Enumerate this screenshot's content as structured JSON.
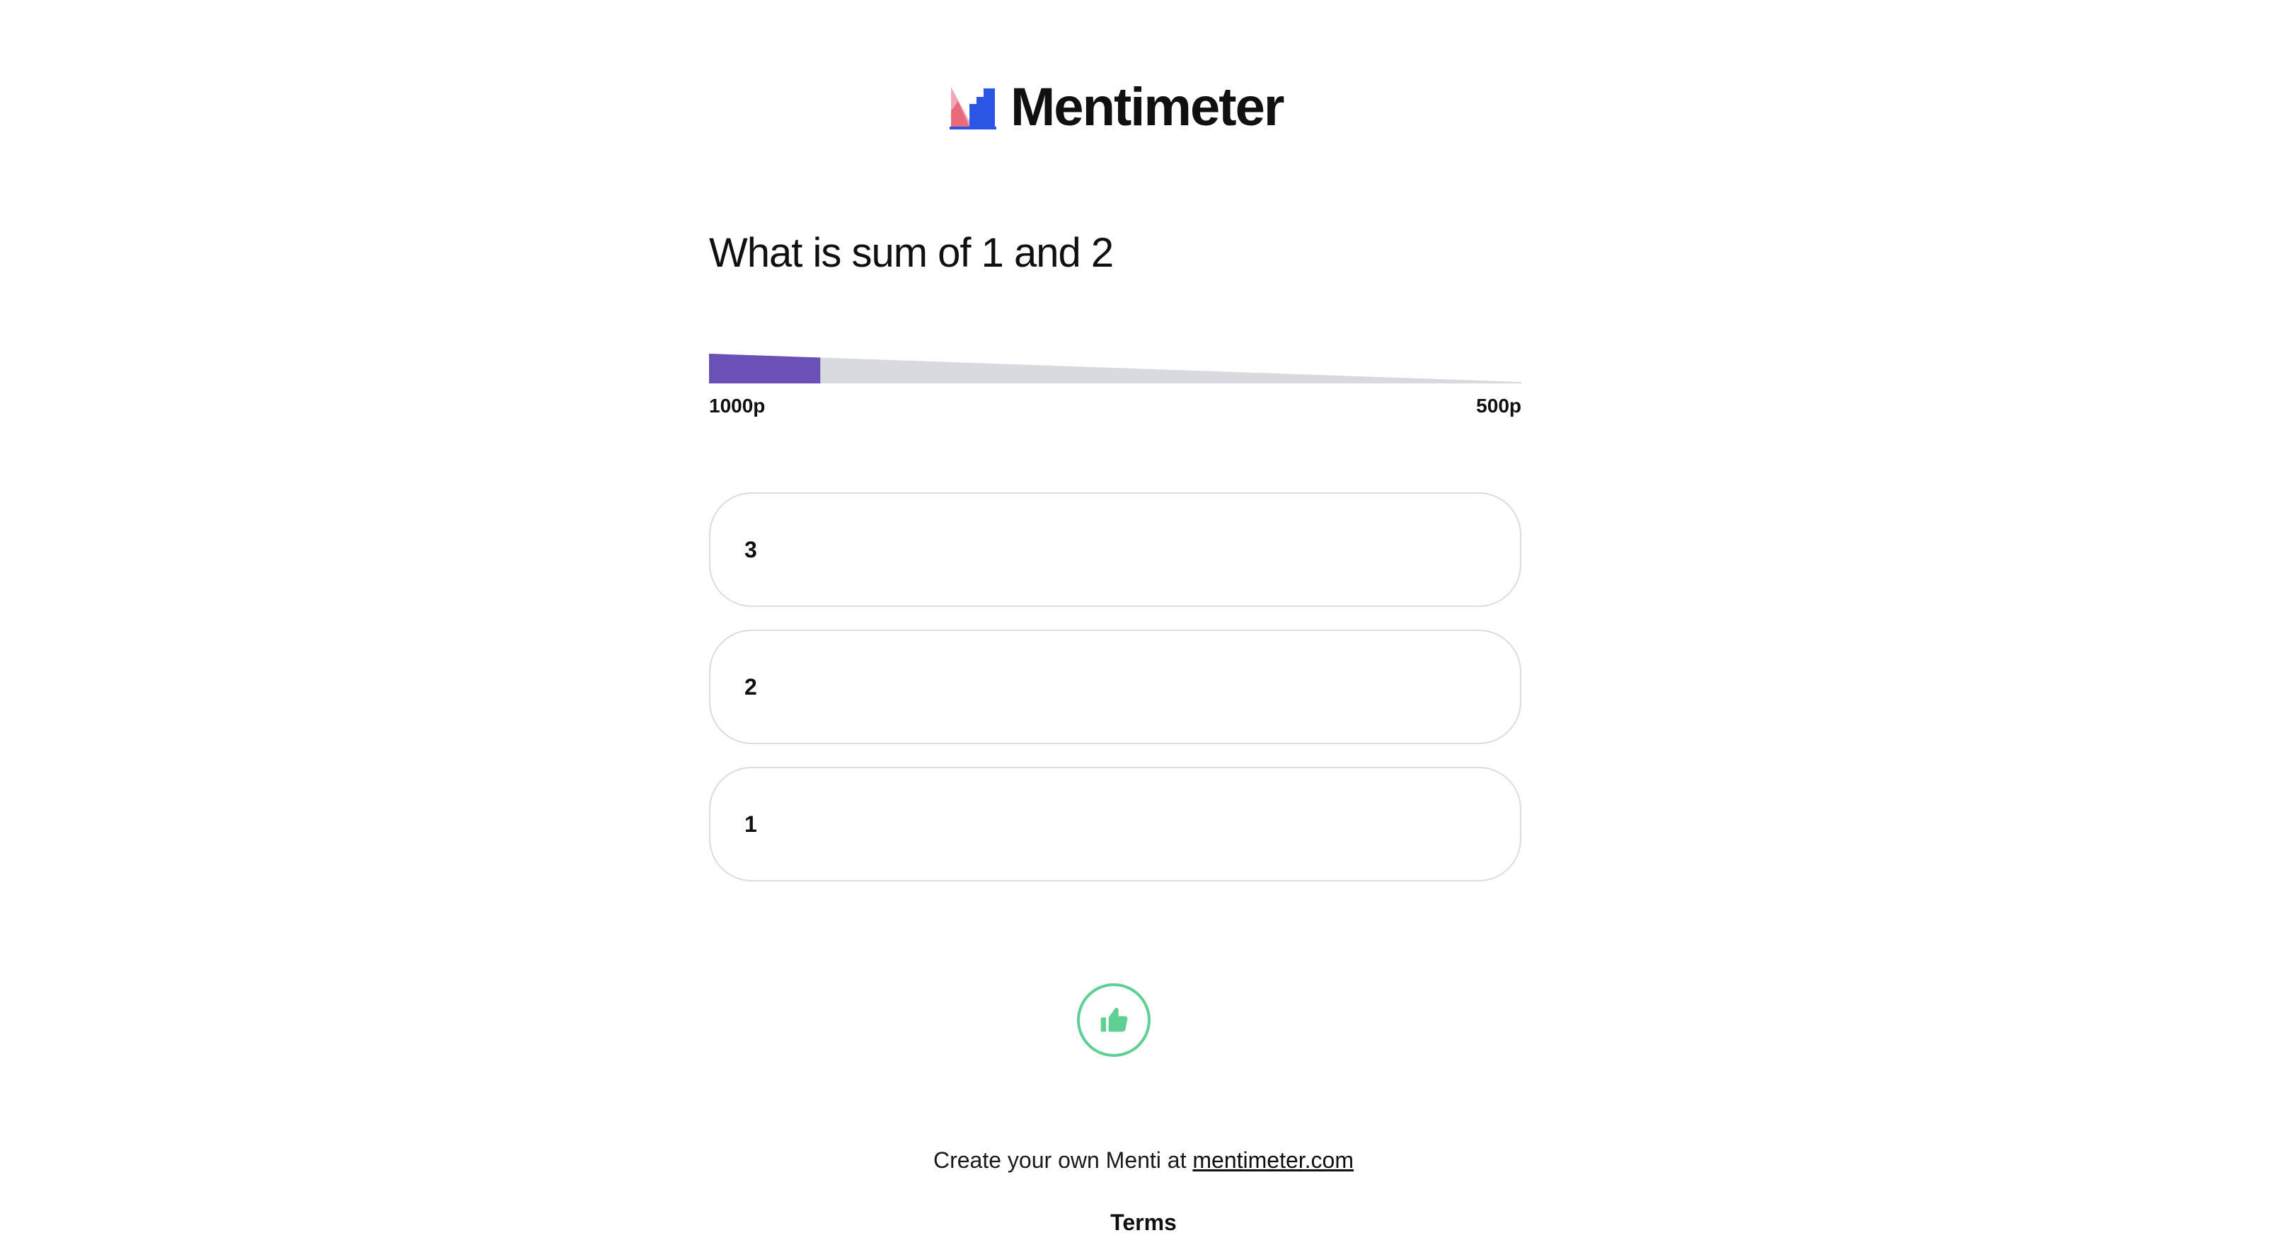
{
  "brand": {
    "name": "Mentimeter",
    "logo_icon": "mentimeter-logo-icon",
    "colors": {
      "pink": "#f2a7b5",
      "red": "#e04b5a",
      "blue": "#2a55e5"
    }
  },
  "question": {
    "title": "What is sum of 1 and 2"
  },
  "points": {
    "start_label": "1000p",
    "end_label": "500p",
    "progress_fraction": 0.137,
    "fill_color": "#6b50b8",
    "track_color": "#d9d9e0"
  },
  "options": [
    {
      "label": "3"
    },
    {
      "label": "2"
    },
    {
      "label": "1"
    }
  ],
  "reaction": {
    "icon": "thumbs-up-icon",
    "color": "#5fcf93"
  },
  "footer": {
    "prefix": "Create your own Menti at ",
    "link_text": "mentimeter.com",
    "terms_label": "Terms"
  }
}
